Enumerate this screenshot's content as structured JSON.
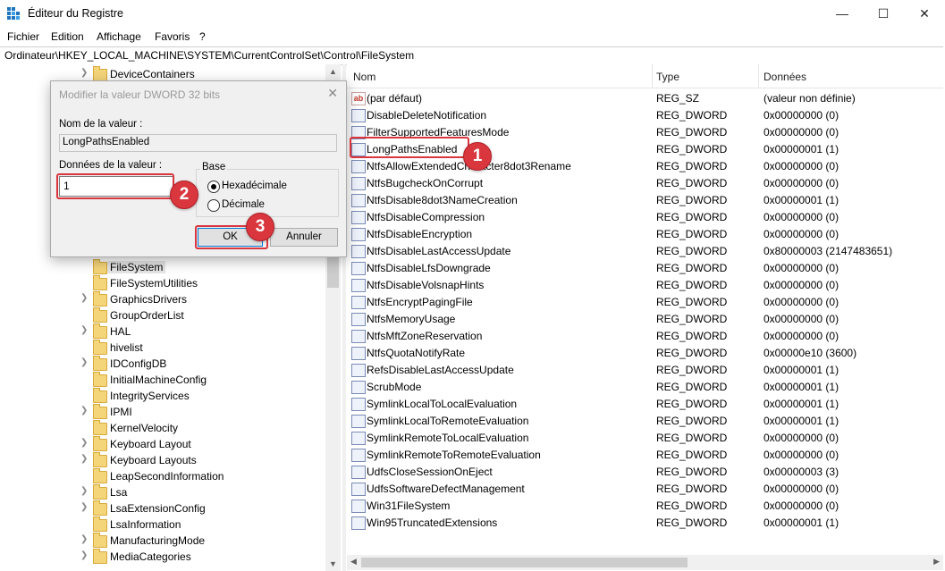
{
  "window": {
    "title": "Éditeur du Registre",
    "minimize": "—",
    "maximize": "☐",
    "close": "✕"
  },
  "menu": [
    "Fichier",
    "Edition",
    "Affichage",
    "Favoris",
    "?"
  ],
  "address": "Ordinateur\\HKEY_LOCAL_MACHINE\\SYSTEM\\CurrentControlSet\\Control\\FileSystem",
  "tree": {
    "top_item": "DeviceContainers",
    "selected": "FileSystem",
    "items": [
      "FileSystemUtilities",
      "GraphicsDrivers",
      "GroupOrderList",
      "HAL",
      "hivelist",
      "IDConfigDB",
      "InitialMachineConfig",
      "IntegrityServices",
      "IPMI",
      "KernelVelocity",
      "Keyboard Layout",
      "Keyboard Layouts",
      "LeapSecondInformation",
      "Lsa",
      "LsaExtensionConfig",
      "LsaInformation",
      "ManufacturingMode",
      "MediaCategories"
    ]
  },
  "list": {
    "columns": [
      "Nom",
      "Type",
      "Données"
    ],
    "rows": [
      {
        "name": "(par défaut)",
        "type": "REG_SZ",
        "data": "(valeur non définie)",
        "icon": "string-value-icon"
      },
      {
        "name": "DisableDeleteNotification",
        "type": "REG_DWORD",
        "data": "0x00000000 (0)"
      },
      {
        "name": "FilterSupportedFeaturesMode",
        "type": "REG_DWORD",
        "data": "0x00000000 (0)"
      },
      {
        "name": "LongPathsEnabled",
        "type": "REG_DWORD",
        "data": "0x00000001 (1)"
      },
      {
        "name": "NtfsAllowExtendedCharacter8dot3Rename",
        "type": "REG_DWORD",
        "data": "0x00000000 (0)"
      },
      {
        "name": "NtfsBugcheckOnCorrupt",
        "type": "REG_DWORD",
        "data": "0x00000000 (0)"
      },
      {
        "name": "NtfsDisable8dot3NameCreation",
        "type": "REG_DWORD",
        "data": "0x00000001 (1)"
      },
      {
        "name": "NtfsDisableCompression",
        "type": "REG_DWORD",
        "data": "0x00000000 (0)"
      },
      {
        "name": "NtfsDisableEncryption",
        "type": "REG_DWORD",
        "data": "0x00000000 (0)"
      },
      {
        "name": "NtfsDisableLastAccessUpdate",
        "type": "REG_DWORD",
        "data": "0x80000003 (2147483651)"
      },
      {
        "name": "NtfsDisableLfsDowngrade",
        "type": "REG_DWORD",
        "data": "0x00000000 (0)"
      },
      {
        "name": "NtfsDisableVolsnapHints",
        "type": "REG_DWORD",
        "data": "0x00000000 (0)"
      },
      {
        "name": "NtfsEncryptPagingFile",
        "type": "REG_DWORD",
        "data": "0x00000000 (0)"
      },
      {
        "name": "NtfsMemoryUsage",
        "type": "REG_DWORD",
        "data": "0x00000000 (0)"
      },
      {
        "name": "NtfsMftZoneReservation",
        "type": "REG_DWORD",
        "data": "0x00000000 (0)"
      },
      {
        "name": "NtfsQuotaNotifyRate",
        "type": "REG_DWORD",
        "data": "0x00000e10 (3600)"
      },
      {
        "name": "RefsDisableLastAccessUpdate",
        "type": "REG_DWORD",
        "data": "0x00000001 (1)"
      },
      {
        "name": "ScrubMode",
        "type": "REG_DWORD",
        "data": "0x00000001 (1)"
      },
      {
        "name": "SymlinkLocalToLocalEvaluation",
        "type": "REG_DWORD",
        "data": "0x00000001 (1)"
      },
      {
        "name": "SymlinkLocalToRemoteEvaluation",
        "type": "REG_DWORD",
        "data": "0x00000001 (1)"
      },
      {
        "name": "SymlinkRemoteToLocalEvaluation",
        "type": "REG_DWORD",
        "data": "0x00000000 (0)"
      },
      {
        "name": "SymlinkRemoteToRemoteEvaluation",
        "type": "REG_DWORD",
        "data": "0x00000000 (0)"
      },
      {
        "name": "UdfsCloseSessionOnEject",
        "type": "REG_DWORD",
        "data": "0x00000003 (3)"
      },
      {
        "name": "UdfsSoftwareDefectManagement",
        "type": "REG_DWORD",
        "data": "0x00000000 (0)"
      },
      {
        "name": "Win31FileSystem",
        "type": "REG_DWORD",
        "data": "0x00000000 (0)"
      },
      {
        "name": "Win95TruncatedExtensions",
        "type": "REG_DWORD",
        "data": "0x00000001 (1)"
      }
    ],
    "dword_icon_text": "011\n110"
  },
  "dialog": {
    "title": "Modifier la valeur DWORD 32 bits",
    "close": "✕",
    "name_label": "Nom de la valeur :",
    "name_value": "LongPathsEnabled",
    "data_label": "Données de la valeur :",
    "data_value": "1",
    "base_label": "Base",
    "hex_label": "Hexadécimale",
    "dec_label": "Décimale",
    "ok_label": "OK",
    "cancel_label": "Annuler"
  },
  "annotations": {
    "badge1": "1",
    "badge2": "2",
    "badge3": "3",
    "color": "#d9363e"
  }
}
